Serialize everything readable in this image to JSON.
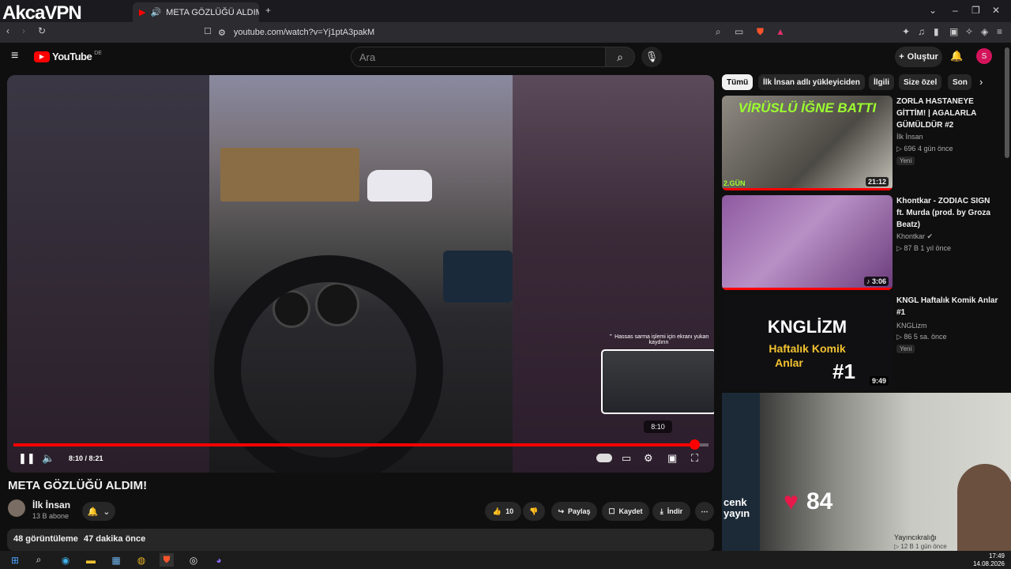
{
  "watermark": {
    "logo_text": "AkcaVPN"
  },
  "browser": {
    "tab_title": "META GÖZLÜĞÜ ALDIM! - Yo",
    "url": "youtube.com/watch?v=Yj1ptA3pakM"
  },
  "youtube": {
    "logo": "YouTube",
    "region": "DE",
    "search_placeholder": "Ara",
    "create_label": "Oluştur",
    "avatar_letter": "S"
  },
  "player": {
    "fine_seek_hint": "⌃ Hassas sarma işlemi için ekranı yukarı kaydırın",
    "preview_time": "8:10",
    "time_display": "8:10 / 8:21",
    "progress_fraction": 0.98
  },
  "video": {
    "title": "META GÖZLÜĞÜ ALDIM!",
    "channel": "İlk İnsan",
    "subscribers": "13 B abone",
    "likes": "10",
    "share_label": "Paylaş",
    "save_label": "Kaydet",
    "download_label": "İndir",
    "desc_views": "48 görüntüleme",
    "desc_age": "47 dakika önce"
  },
  "chips": [
    "Tümü",
    "İlk İnsan adlı yükleyiciden",
    "İlgili",
    "Size özel",
    "Son"
  ],
  "recommendations": [
    {
      "title": "ZORLA HASTANEYE GİTTİM! | AGALARLA GÜMÜLDÜR #2",
      "channel": "İlk İnsan",
      "meta": "▷ 696  4 gün önce",
      "badge": "Yeni",
      "duration": "21:12",
      "thumb_text": "VİRÜSLÜ İĞNE BATTI",
      "thumb_corner": "2.GÜN"
    },
    {
      "title": "Khontkar - ZODIAC SIGN ft. Murda (prod. by Groza Beatz)",
      "channel": "Khontkar",
      "meta": "▷ 87 B  1 yıl önce",
      "badge": "",
      "duration": "♪ 3:06"
    },
    {
      "title": "KNGL Haftalık Komik Anlar #1",
      "channel": "KNGLizm",
      "meta": "▷ 86  5 sa. önce",
      "badge": "Yeni",
      "duration": "9:49",
      "thumb_line1": "KNGLİZM",
      "thumb_line2": "Haftalık Komik",
      "thumb_line3": "Anlar",
      "thumb_line4": "#1"
    }
  ],
  "partial_rec": {
    "thumb_text": "cenk yayın",
    "channel": "Yayıncıkralığı",
    "meta": "▷ 12 B  1 gün önce"
  },
  "overlay": {
    "heart_rate": "84"
  },
  "taskbar": {
    "time": "17:49",
    "date": "14.08.2026"
  },
  "colors": {
    "accent": "#ff0000",
    "background": "#0f0f0f",
    "avatar": "#d3145a"
  }
}
